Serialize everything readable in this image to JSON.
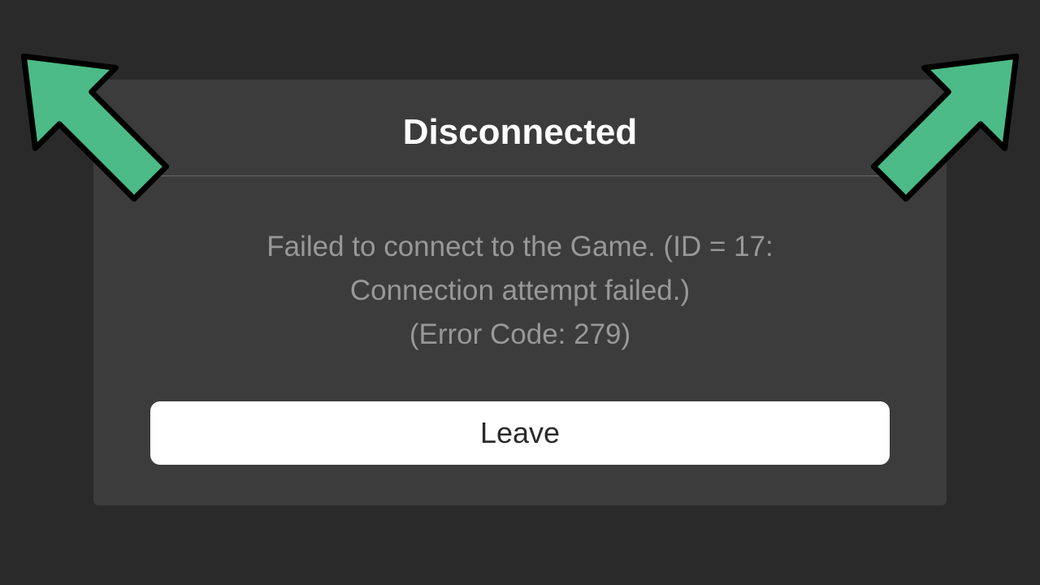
{
  "dialog": {
    "title": "Disconnected",
    "message_line1": "Failed to connect to the Game. (ID = 17:",
    "message_line2": "Connection attempt failed.)",
    "message_line3": "(Error Code: 279)",
    "button_label": "Leave"
  },
  "colors": {
    "arrow": "#4CBB87"
  }
}
